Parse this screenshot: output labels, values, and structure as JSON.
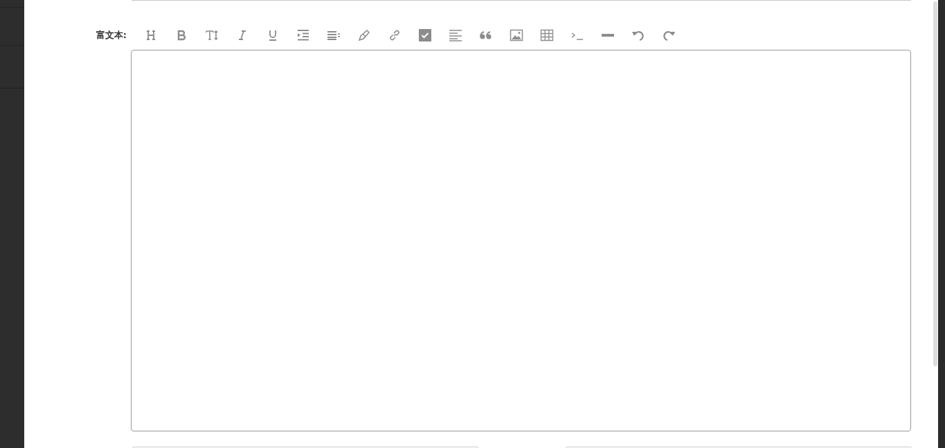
{
  "editor_field": {
    "label": "富文本:",
    "toolbar": [
      {
        "kind": "heading"
      },
      {
        "kind": "bold"
      },
      {
        "kind": "font-size"
      },
      {
        "kind": "italic"
      },
      {
        "kind": "underline"
      },
      {
        "kind": "indent"
      },
      {
        "kind": "line-height"
      },
      {
        "kind": "pen"
      },
      {
        "kind": "link"
      },
      {
        "kind": "checkbox"
      },
      {
        "kind": "align"
      },
      {
        "kind": "quote"
      },
      {
        "kind": "image"
      },
      {
        "kind": "table"
      },
      {
        "kind": "code"
      },
      {
        "kind": "divider"
      },
      {
        "kind": "undo"
      },
      {
        "kind": "redo"
      }
    ]
  }
}
